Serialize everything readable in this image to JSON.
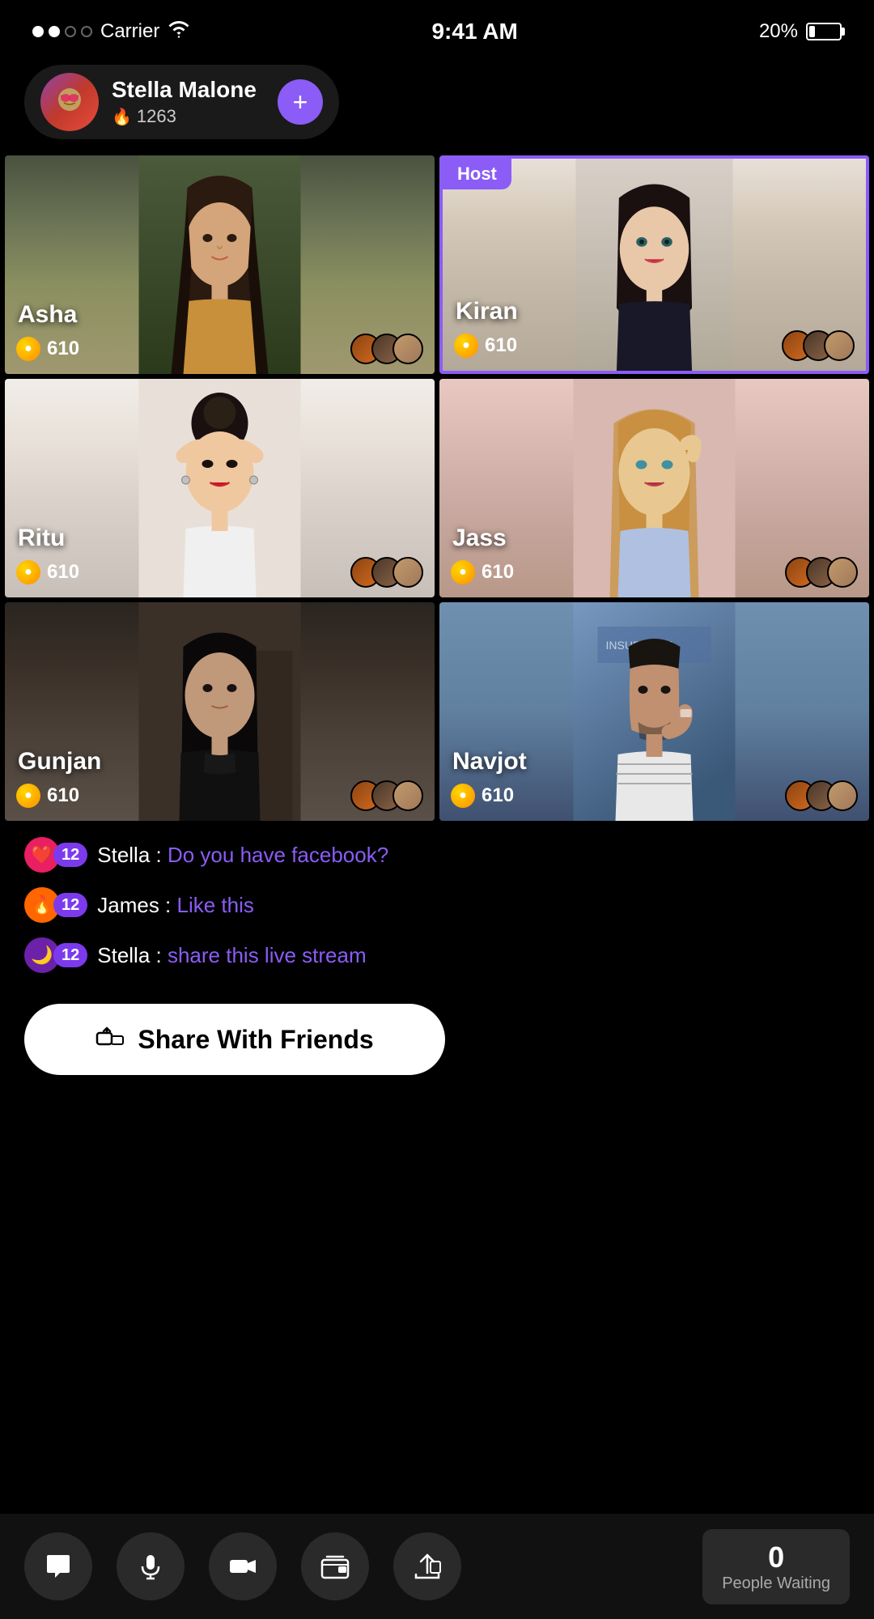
{
  "statusBar": {
    "carrier": "Carrier",
    "time": "9:41 AM",
    "battery": "20%"
  },
  "profile": {
    "name": "Stella Malone",
    "score": "1263",
    "addButton": "+"
  },
  "grid": [
    {
      "name": "Asha",
      "score": "610",
      "isHost": false,
      "bgClass": "bg-asha",
      "id": "asha"
    },
    {
      "name": "Kiran",
      "score": "610",
      "isHost": true,
      "bgClass": "bg-kiran",
      "id": "kiran"
    },
    {
      "name": "Ritu",
      "score": "610",
      "isHost": false,
      "bgClass": "bg-ritu",
      "id": "ritu"
    },
    {
      "name": "Jass",
      "score": "610",
      "isHost": false,
      "bgClass": "bg-jass",
      "id": "jass"
    },
    {
      "name": "Gunjan",
      "score": "610",
      "isHost": false,
      "bgClass": "bg-gunjan",
      "id": "gunjan"
    },
    {
      "name": "Navjot",
      "score": "610",
      "isHost": false,
      "bgClass": "bg-navjot",
      "id": "navjot"
    }
  ],
  "chat": {
    "hostBadgeLabel": "Host",
    "messages": [
      {
        "user": "Stella",
        "message": "Do you have facebook?",
        "badgeType": "heart",
        "badgeNumber": "12"
      },
      {
        "user": "James",
        "message": "Like this",
        "badgeType": "fire",
        "badgeNumber": "12"
      },
      {
        "user": "Stella",
        "message": "share this live stream",
        "badgeType": "moon",
        "badgeNumber": "12"
      }
    ]
  },
  "shareButton": {
    "label": "Share With Friends"
  },
  "bottomBar": {
    "peopleWaiting": {
      "count": "0",
      "label": "People Waiting"
    },
    "buttons": [
      {
        "id": "chat",
        "icon": "💬"
      },
      {
        "id": "mic",
        "icon": "🎤"
      },
      {
        "id": "video",
        "icon": "📹"
      },
      {
        "id": "wallet",
        "icon": "👜"
      },
      {
        "id": "share",
        "icon": "↗"
      }
    ]
  }
}
